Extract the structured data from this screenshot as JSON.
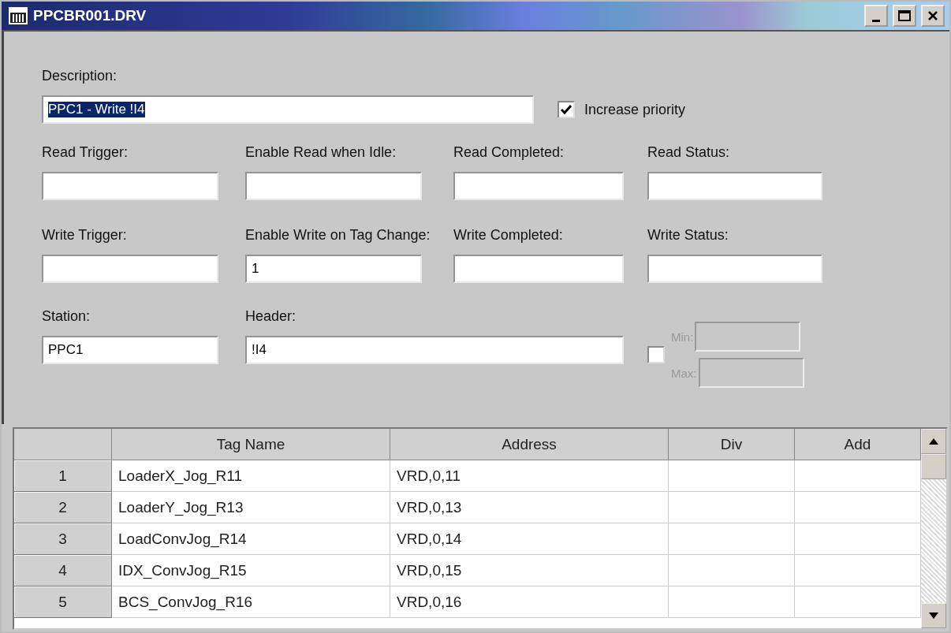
{
  "window": {
    "title": "PPCBR001.DRV"
  },
  "description": {
    "label": "Description:",
    "value": "PPC1 - Write !I4",
    "text_selected": true
  },
  "increase_priority": {
    "label": "Increase priority",
    "checked": true
  },
  "field_rows": [
    [
      {
        "label": "Read Trigger:"
      },
      {
        "label": "Enable Read when Idle:"
      },
      {
        "label": "Read Completed:"
      },
      {
        "label": "Read Status:"
      }
    ],
    [
      {
        "label": "Write Trigger:"
      },
      {
        "label": "Enable Write on Tag Change:",
        "value": "1"
      },
      {
        "label": "Write Completed:"
      },
      {
        "label": "Write Status:"
      }
    ]
  ],
  "station": {
    "label": "Station:",
    "value": "PPC1"
  },
  "header": {
    "label": "Header:",
    "value": "!I4"
  },
  "range": {
    "checked": false,
    "disabled": true,
    "min": {
      "label": "Min:"
    },
    "max": {
      "label": "Max:"
    }
  },
  "table": {
    "columns": [
      "Tag Name",
      "Address",
      "Div",
      "Add"
    ],
    "rows": [
      {
        "number": "1",
        "cells": [
          "LoaderX_Jog_R11",
          "VRD,0,11",
          null,
          null
        ]
      },
      {
        "number": "2",
        "cells": [
          "LoaderY_Jog_R13",
          "VRD,0,13",
          null,
          null
        ]
      },
      {
        "number": "3",
        "cells": [
          "LoadConvJog_R14",
          "VRD,0,14",
          null,
          null
        ]
      },
      {
        "number": "4",
        "cells": [
          "IDX_ConvJog_R15",
          "VRD,0,15",
          null,
          null
        ]
      },
      {
        "number": "5",
        "cells": [
          "BCS_ConvJog_R16",
          "VRD,0,16",
          null,
          null
        ]
      }
    ]
  }
}
